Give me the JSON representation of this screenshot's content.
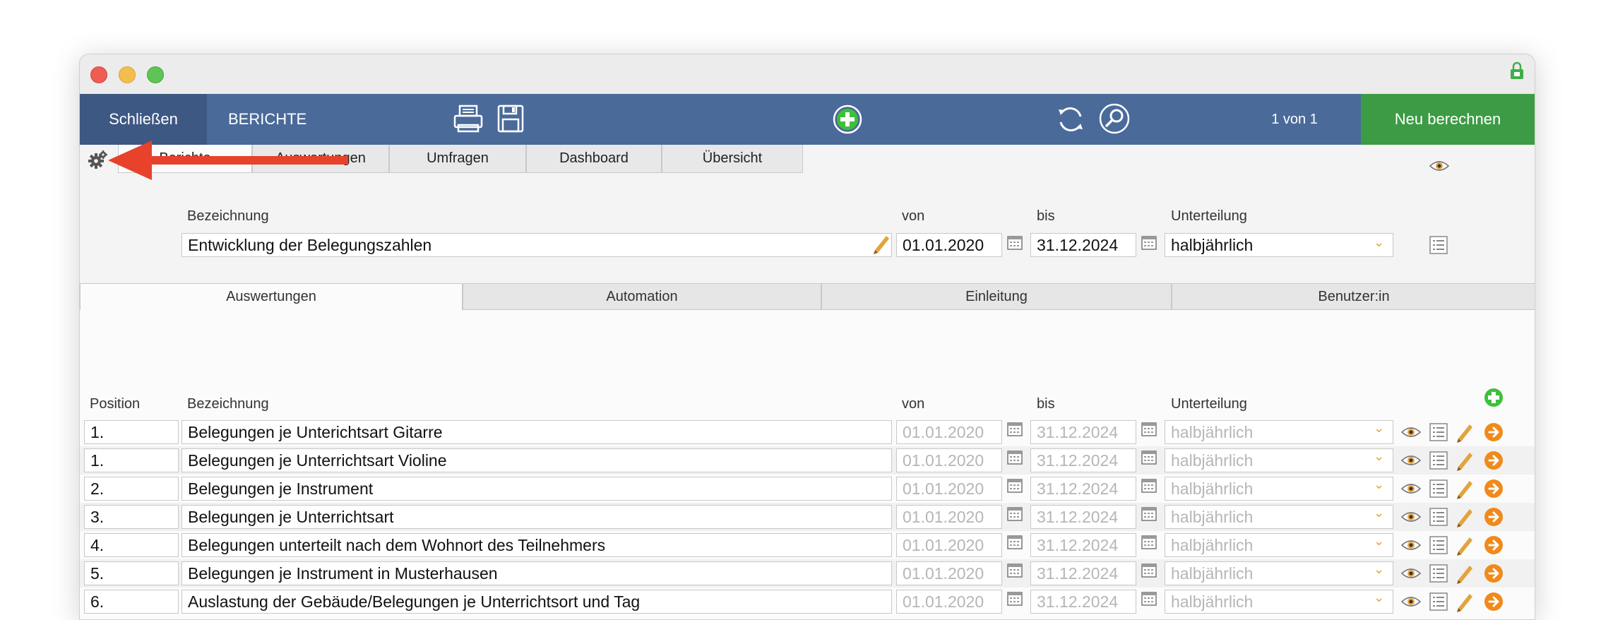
{
  "toolbar": {
    "close_label": "Schließen",
    "module_title": "BERICHTE",
    "record_count": "1 von 1",
    "recalc_label": "Neu berechnen"
  },
  "top_tabs": [
    "Berichte",
    "Auswertungen",
    "Umfragen",
    "Dashboard",
    "Übersicht"
  ],
  "report": {
    "bezeichnung_label": "Bezeichnung",
    "von_label": "von",
    "bis_label": "bis",
    "unterteilung_label": "Unterteilung",
    "bezeichnung": "Entwicklung der Belegungszahlen",
    "von": "01.01.2020",
    "bis": "31.12.2024",
    "unterteilung": "halbjährlich"
  },
  "sub_tabs": [
    "Auswertungen",
    "Automation",
    "Einleitung",
    "Benutzer:in"
  ],
  "table": {
    "headers": {
      "position": "Position",
      "bezeichnung": "Bezeichnung",
      "von": "von",
      "bis": "bis",
      "unterteilung": "Unterteilung"
    },
    "rows": [
      {
        "position": "1.",
        "bezeichnung": "Belegungen je Unterichtsart Gitarre",
        "von": "01.01.2020",
        "bis": "31.12.2024",
        "unterteilung": "halbjährlich"
      },
      {
        "position": "1.",
        "bezeichnung": "Belegungen je Unterrichtsart Violine",
        "von": "01.01.2020",
        "bis": "31.12.2024",
        "unterteilung": "halbjährlich"
      },
      {
        "position": "2.",
        "bezeichnung": "Belegungen je Instrument",
        "von": "01.01.2020",
        "bis": "31.12.2024",
        "unterteilung": "halbjährlich"
      },
      {
        "position": "3.",
        "bezeichnung": "Belegungen je Unterrichtsart",
        "von": "01.01.2020",
        "bis": "31.12.2024",
        "unterteilung": "halbjährlich"
      },
      {
        "position": "4.",
        "bezeichnung": "Belegungen unterteilt nach dem Wohnort des Teilnehmers",
        "von": "01.01.2020",
        "bis": "31.12.2024",
        "unterteilung": "halbjährlich"
      },
      {
        "position": "5.",
        "bezeichnung": "Belegungen je Instrument in Musterhausen",
        "von": "01.01.2020",
        "bis": "31.12.2024",
        "unterteilung": "halbjährlich"
      },
      {
        "position": "6.",
        "bezeichnung": "Auslastung der Gebäude/Belegungen je Unterrichtsort und Tag",
        "von": "01.01.2020",
        "bis": "31.12.2024",
        "unterteilung": "halbjährlich"
      }
    ]
  },
  "icons": {
    "gear": "gear-icon",
    "print": "printer-icon",
    "save": "save-icon",
    "add": "add-icon",
    "refresh": "refresh-icon",
    "search": "search-icon",
    "eye": "eye-icon",
    "list": "list-icon",
    "edit": "pencil-icon",
    "go": "arrow-right-icon",
    "calendar": "calendar-icon",
    "lock": "lock-icon"
  },
  "colors": {
    "toolbar": "#4a6a9a",
    "close_button": "#3d5883",
    "recalc_button": "#3d9b45",
    "add_green": "#3fbf3a",
    "orange": "#f08a1c",
    "annotation_arrow": "#e8412c"
  }
}
